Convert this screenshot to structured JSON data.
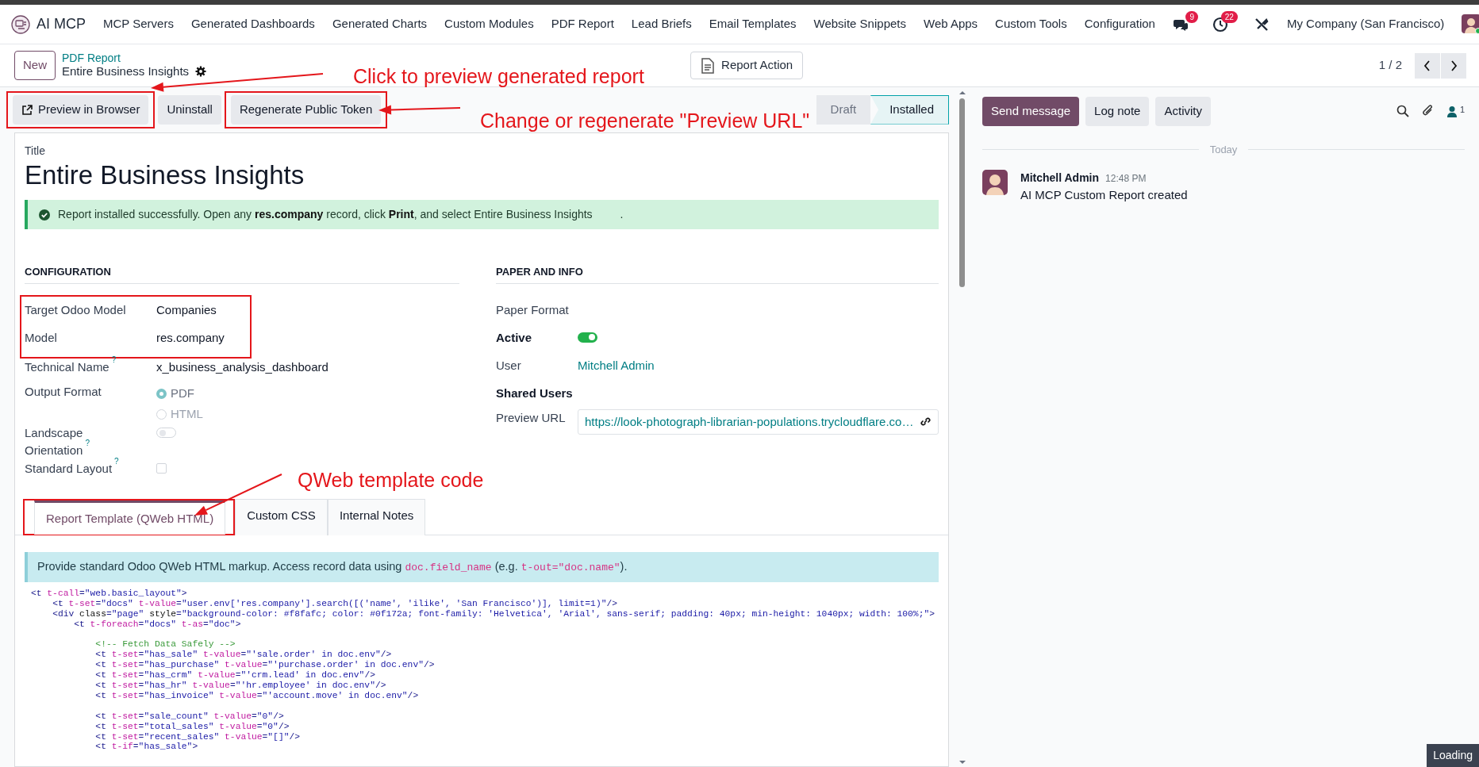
{
  "navbar": {
    "app_name": "AI MCP",
    "menu": [
      "MCP Servers",
      "Generated Dashboards",
      "Generated Charts",
      "Custom Modules",
      "PDF Report",
      "Lead Briefs",
      "Email Templates",
      "Website Snippets",
      "Web Apps",
      "Custom Tools",
      "Configuration"
    ],
    "messages_count": "9",
    "activities_count": "22",
    "company": "My Company (San Francisco)"
  },
  "control_panel": {
    "new_button": "New",
    "breadcrumb": "PDF Report",
    "record_name": "Entire Business Insights",
    "action_button": "Report Action",
    "pager": "1 / 2"
  },
  "header_buttons": [
    {
      "label": "Preview in Browser",
      "kind": "external",
      "highlighted": true
    },
    {
      "label": "Uninstall",
      "kind": "plain",
      "highlighted": false
    },
    {
      "label": "Regenerate Public Token",
      "kind": "plain",
      "highlighted": true
    }
  ],
  "status_steps": [
    {
      "label": "Draft",
      "selected": false
    },
    {
      "label": "Installed",
      "selected": true
    }
  ],
  "form": {
    "title_label": "Title",
    "title": "Entire Business Insights",
    "alert": "Report installed successfully. Open any **res.company** record, click **Print**, and select Entire Business Insights         .",
    "configuration": {
      "heading": "CONFIGURATION",
      "fields": [
        {
          "kind": "text",
          "label": "Target Odoo Model",
          "value": "Companies",
          "highlighted": true
        },
        {
          "kind": "text",
          "label": "Model",
          "value": "res.company",
          "highlighted": true
        },
        {
          "kind": "text",
          "label": "Technical Name",
          "help": "?",
          "value": "x_business_analysis_dashboard",
          "highlighted": false
        },
        {
          "kind": "radio",
          "label": "Output Format",
          "options": [
            {
              "label": "PDF",
              "selected": true
            },
            {
              "label": "HTML",
              "selected": false
            }
          ],
          "highlighted": false
        },
        {
          "kind": "toggle",
          "label": "Landscape Orientation",
          "help": "?",
          "on": false,
          "highlighted": false
        },
        {
          "kind": "checkbox",
          "label": "Standard Layout",
          "help": "?",
          "checked": false,
          "highlighted": false
        }
      ]
    },
    "paper_info": {
      "heading": "PAPER AND INFO",
      "fields": [
        {
          "kind": "empty",
          "label": "Paper Format",
          "bold": false
        },
        {
          "kind": "toggle",
          "label": "Active",
          "bold": true,
          "on": true
        },
        {
          "kind": "link",
          "label": "User",
          "value": "Mitchell Admin",
          "bold": false
        },
        {
          "kind": "empty",
          "label": "Shared Users",
          "bold": true
        },
        {
          "kind": "url",
          "label": "Preview URL",
          "value": "https://look-photograph-librarian-populations.trycloudflare.co…",
          "bold": false
        }
      ]
    },
    "tabs": [
      {
        "label": "Report Template (QWeb HTML)",
        "selected": true,
        "highlighted": true
      },
      {
        "label": "Custom CSS",
        "selected": false,
        "highlighted": false
      },
      {
        "label": "Internal Notes",
        "selected": false,
        "highlighted": false
      }
    ],
    "template_hint": [
      {
        "kind": "text",
        "text": "Provide standard Odoo QWeb HTML markup. Access record data using "
      },
      {
        "kind": "code",
        "text": "doc.field_name"
      },
      {
        "kind": "text",
        "text": " (e.g. "
      },
      {
        "kind": "code",
        "text": "t-out=\"doc.name\""
      },
      {
        "kind": "text",
        "text": ")."
      }
    ],
    "code": "<t t-call=\"web.basic_layout\">\n    <t t-set=\"docs\" t-value=\"user.env['res.company'].search([('name', 'ilike', 'San Francisco')], limit=1)\"/>\n    <div class=\"page\" style=\"background-color: #f8fafc; color: #0f172a; font-family: 'Helvetica', 'Arial', sans-serif; padding: 40px; min-height: 1040px; width: 100%;\">\n        <t t-foreach=\"docs\" t-as=\"doc\">\n\n            <!-- Fetch Data Safely -->\n            <t t-set=\"has_sale\" t-value=\"'sale.order' in doc.env\"/>\n            <t t-set=\"has_purchase\" t-value=\"'purchase.order' in doc.env\"/>\n            <t t-set=\"has_crm\" t-value=\"'crm.lead' in doc.env\"/>\n            <t t-set=\"has_hr\" t-value=\"'hr.employee' in doc.env\"/>\n            <t t-set=\"has_invoice\" t-value=\"'account.move' in doc.env\"/>\n\n            <t t-set=\"sale_count\" t-value=\"0\"/>\n            <t t-set=\"total_sales\" t-value=\"0\"/>\n            <t t-set=\"recent_sales\" t-value=\"[]\"/>\n            <t t-if=\"has_sale\">"
  },
  "chatter": {
    "buttons": [
      {
        "label": "Send message",
        "selected": true
      },
      {
        "label": "Log note",
        "selected": false
      },
      {
        "label": "Activity",
        "selected": false
      }
    ],
    "followers_count": "1",
    "date_separator": "Today",
    "messages": [
      {
        "author": "Mitchell Admin",
        "time": "12:48 PM",
        "body": "AI MCP Custom Report created"
      }
    ]
  },
  "loading_indicator": "Loading",
  "annotations": [
    {
      "text": "Click to preview generated report"
    },
    {
      "text": "Change or regenerate \"Preview URL\""
    },
    {
      "text": "QWeb template code"
    }
  ]
}
